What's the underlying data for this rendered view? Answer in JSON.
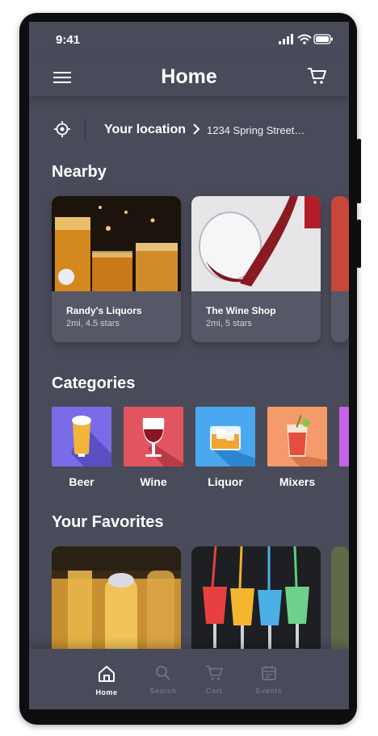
{
  "status_bar": {
    "time": "9:41"
  },
  "header": {
    "title": "Home"
  },
  "location": {
    "label": "Your location",
    "address": "1234 Spring Street…"
  },
  "nearby": {
    "title": "Nearby",
    "stores": [
      {
        "name": "Randy's Liquors",
        "meta": "2mi, 4.5 stars"
      },
      {
        "name": "The Wine Shop",
        "meta": "2mi, 5 stars"
      }
    ]
  },
  "categories": {
    "title": "Categories",
    "items": [
      {
        "label": "Beer",
        "color": "#7a6ce8"
      },
      {
        "label": "Wine",
        "color": "#e25560"
      },
      {
        "label": "Liquor",
        "color": "#4aa8f0"
      },
      {
        "label": "Mixers",
        "color": "#f59a6a"
      }
    ]
  },
  "favorites": {
    "title": "Your Favorites"
  },
  "tabbar": {
    "items": [
      {
        "label": "Home",
        "icon": "home-icon",
        "active": true
      },
      {
        "label": "Search",
        "icon": "search-icon",
        "active": false
      },
      {
        "label": "Cart",
        "icon": "cart-icon",
        "active": false
      },
      {
        "label": "Events",
        "icon": "events-icon",
        "active": false
      }
    ]
  }
}
